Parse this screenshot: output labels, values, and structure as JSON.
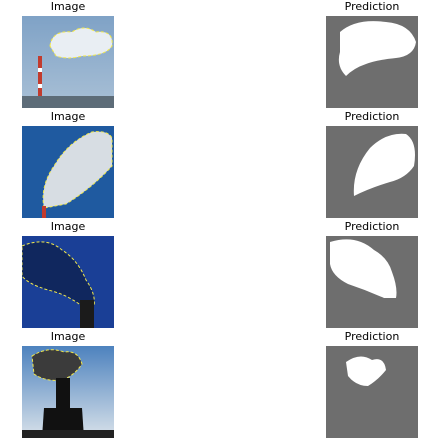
{
  "rows": [
    {
      "image_title": "Image",
      "prediction_title": "Prediction"
    },
    {
      "image_title": "Image",
      "prediction_title": "Prediction"
    },
    {
      "image_title": "Image",
      "prediction_title": "Prediction"
    },
    {
      "image_title": "Image",
      "prediction_title": "Prediction"
    }
  ],
  "colors": {
    "mask_background": "#6e6e6e",
    "mask_foreground": "#ffffff",
    "outline": "#f2e84a",
    "sky": "#3f78b6"
  }
}
